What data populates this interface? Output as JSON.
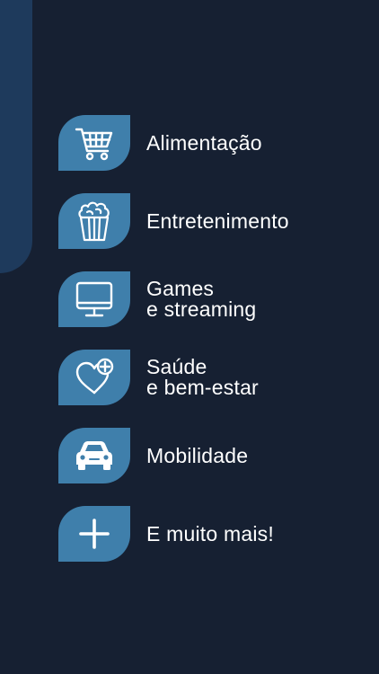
{
  "colors": {
    "background": "#162032",
    "side_accent": "#1e3a5c",
    "tile": "#3f7fab",
    "text": "#ffffff"
  },
  "features": [
    {
      "icon": "shopping-cart-icon",
      "lines": [
        "Alimentação"
      ]
    },
    {
      "icon": "popcorn-icon",
      "lines": [
        "Entretenimento"
      ]
    },
    {
      "icon": "monitor-icon",
      "lines": [
        "Games",
        "e streaming"
      ]
    },
    {
      "icon": "heart-plus-icon",
      "lines": [
        "Saúde",
        "e bem-estar"
      ]
    },
    {
      "icon": "car-icon",
      "lines": [
        "Mobilidade"
      ]
    },
    {
      "icon": "plus-icon",
      "lines": [
        "E muito mais!"
      ]
    }
  ]
}
